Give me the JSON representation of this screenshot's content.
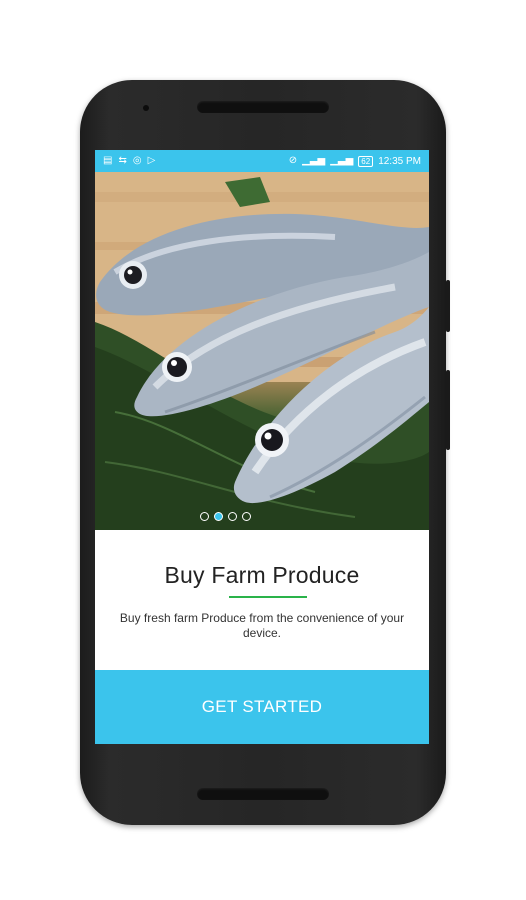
{
  "status_bar": {
    "left_icons": [
      "sd-card-icon",
      "data-icon",
      "whatsapp-icon",
      "play-store-icon"
    ],
    "right_icons": [
      "alarm-icon",
      "signal-4g-icon",
      "signal-bars-icon"
    ],
    "battery": "62",
    "time": "12:35 PM"
  },
  "onboarding": {
    "slide_count": 4,
    "active_slide": 2,
    "title": "Buy Farm Produce",
    "description": "Buy fresh farm Produce from the convenience of your device.",
    "cta_label": "GET STARTED"
  },
  "colors": {
    "accent": "#3bc4ec",
    "underline": "#2ab34a",
    "title_text": "#222222"
  }
}
